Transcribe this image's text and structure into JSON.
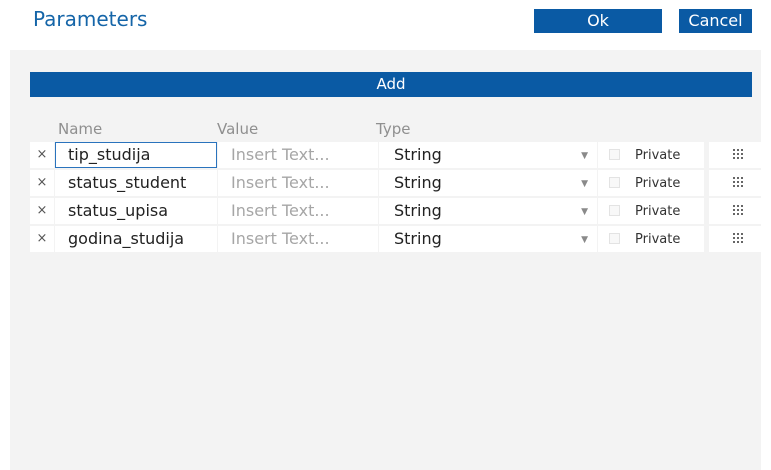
{
  "header": {
    "title": "Parameters",
    "ok_label": "Ok",
    "cancel_label": "Cancel"
  },
  "panel": {
    "add_label": "Add",
    "columns": {
      "name": "Name",
      "value": "Value",
      "type": "Type"
    },
    "rows": [
      {
        "delete": "×",
        "name": "tip_studija",
        "value_placeholder": "Insert Text...",
        "type": "String",
        "private_label": "Private",
        "private_checked": false
      },
      {
        "delete": "×",
        "name": "status_student",
        "value_placeholder": "Insert Text...",
        "type": "String",
        "private_label": "Private",
        "private_checked": false
      },
      {
        "delete": "×",
        "name": "status_upisa",
        "value_placeholder": "Insert Text...",
        "type": "String",
        "private_label": "Private",
        "private_checked": false
      },
      {
        "delete": "×",
        "name": "godina_studija",
        "value_placeholder": "Insert Text...",
        "type": "String",
        "private_label": "Private",
        "private_checked": false
      }
    ]
  },
  "icons": {
    "delete": "close-icon",
    "dropdown": "chevron-down-icon",
    "drag": "drag-handle-icon"
  },
  "colors": {
    "accent": "#0a5aa4",
    "title": "#1565a8",
    "panel_bg": "#f3f3f3",
    "placeholder": "#a6a6a6"
  }
}
